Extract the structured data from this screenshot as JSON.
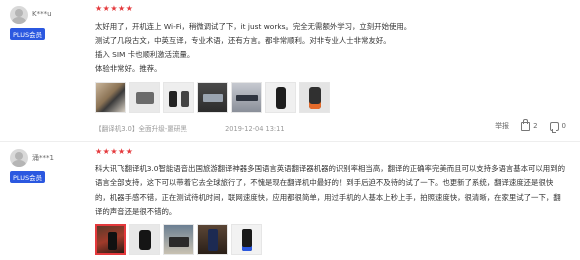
{
  "reviews": [
    {
      "username": "K***u",
      "badge": "PLUS会员",
      "stars": "★★★★★",
      "lines": [
        "太好用了，开机连上 Wi-Fi，稍微调试了下，it just works。完全无需额外学习，立刻开始使用。",
        "测试了几段古文，中英互译，专业术语，还有方言。都非常顺利。对非专业人士非常友好。",
        "插入 SIM 卡也顺利激活流量。",
        "体验非常好。推荐。"
      ],
      "images": [
        "product-photo-1",
        "product-photo-2",
        "product-photo-3",
        "product-photo-4",
        "product-photo-5",
        "product-photo-6",
        "product-photo-7"
      ],
      "meta_product": "【翻译机3.0】全面升级-噩研黑",
      "meta_date": "2019-12-04 13:11",
      "report_label": "举报",
      "like_icon": "thumbs-up-icon",
      "like_count": "2",
      "comment_icon": "comment-icon",
      "comment_count": "0"
    },
    {
      "username": "涌***1",
      "badge": "PLUS会员",
      "stars": "★★★★★",
      "text": "科大讯飞翻译机3.0智能语音出国旅游翻译神器多国语言英语翻译器机器的识别率相当高，翻译的正确率完美而且可以支持多语言基本可以用到的语言全部支持，这下可以带着它去全球旅行了，不愧是现在翻译机中最好的！到手后迫不及待的试了一下。也更新了系统，翻译速度还是很快的，机器手感不错，正在测试待机时间，联网速度快，应用都很简单，用过手机的人基本上秒上手，拍照速度快，很清晰，在家里试了一下，翻译的声音还是很不错的。",
      "images": [
        "product-photo-1",
        "product-photo-2",
        "product-photo-3",
        "product-photo-4",
        "product-photo-5"
      ]
    }
  ]
}
